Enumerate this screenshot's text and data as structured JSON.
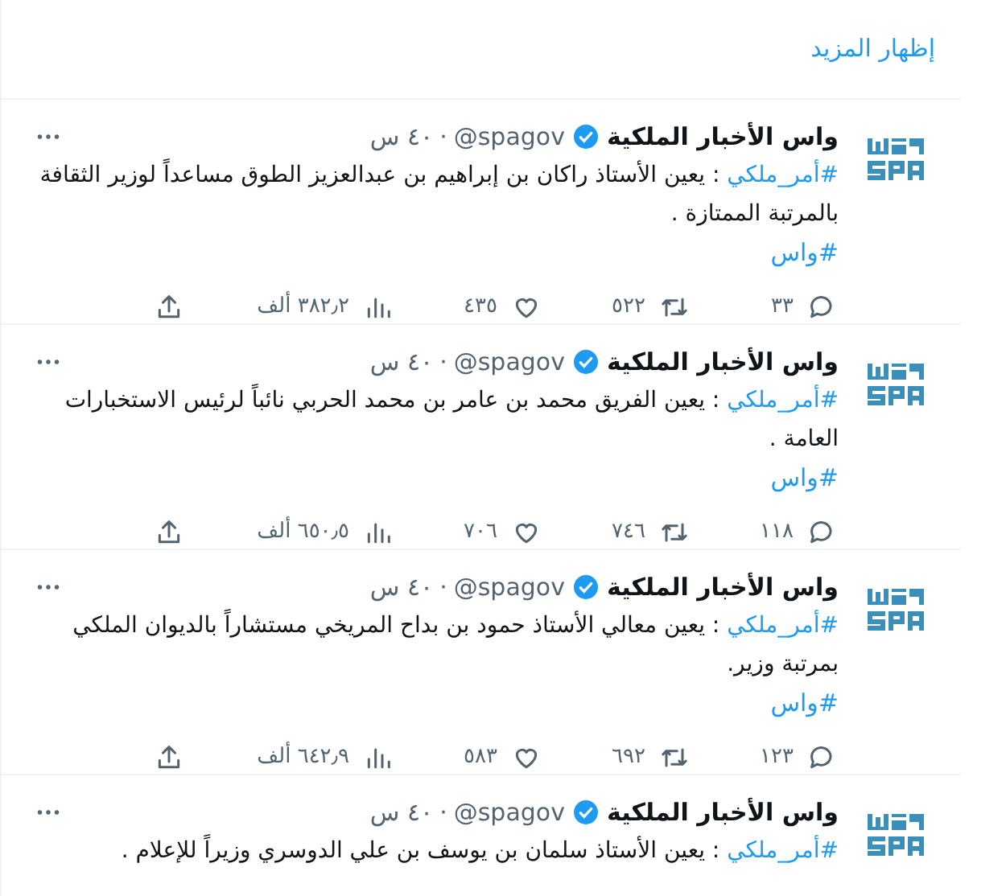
{
  "show_more": "إظهار المزيد",
  "tweets": [
    {
      "name": "واس الأخبار الملكية",
      "verified": true,
      "handle": "@spagov",
      "separator": "·",
      "time": "٤٠ س",
      "tag": "#أمر_ملكي",
      "text": " : يعين الأستاذ راكان بن إبراهيم بن عبدالعزيز الطوق مساعداً لوزير الثقافة بالمرتبة الممتازة .",
      "hashtag": "#واس",
      "replies": "٣٣",
      "retweets": "٥٢٢",
      "likes": "٤٣٥",
      "views": "٣٨٢٫٢ ألف"
    },
    {
      "name": "واس الأخبار الملكية",
      "verified": true,
      "handle": "@spagov",
      "separator": "·",
      "time": "٤٠ س",
      "tag": "#أمر_ملكي",
      "text": " : يعين الفريق محمد بن عامر بن محمد الحربي نائباً لرئيس الاستخبارات العامة .",
      "hashtag": "#واس",
      "replies": "١١٨",
      "retweets": "٧٤٦",
      "likes": "٧٠٦",
      "views": "٦٥٠٫٥ ألف"
    },
    {
      "name": "واس الأخبار الملكية",
      "verified": true,
      "handle": "@spagov",
      "separator": "·",
      "time": "٤٠ س",
      "tag": "#أمر_ملكي",
      "text": " : يعين معالي الأستاذ حمود بن بداح المريخي مستشاراً بالديوان الملكي بمرتبة وزير.",
      "hashtag": "#واس",
      "replies": "١٢٣",
      "retweets": "٦٩٢",
      "likes": "٥٨٣",
      "views": "٦٤٢٫٩ ألف"
    },
    {
      "name": "واس الأخبار الملكية",
      "verified": true,
      "handle": "@spagov",
      "separator": "·",
      "time": "٤٠ س",
      "tag": "#أمر_ملكي",
      "text": " : يعين الأستاذ سلمان بن يوسف بن علي الدوسري وزيراً للإعلام ."
    }
  ]
}
